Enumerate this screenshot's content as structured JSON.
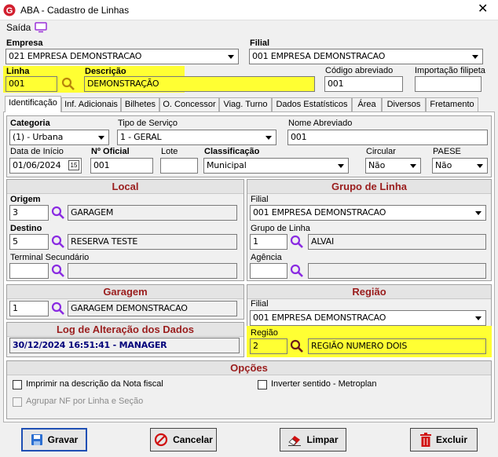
{
  "window": {
    "title": "ABA - Cadastro de Linhas"
  },
  "menu": {
    "saida": "Saída"
  },
  "empresa": {
    "label": "Empresa",
    "value": "021 EMPRESA DEMONSTRACAO"
  },
  "filial": {
    "label": "Filial",
    "value": "001 EMPRESA DEMONSTRACAO"
  },
  "linha": {
    "label": "Linha",
    "value": "001"
  },
  "descricao": {
    "label": "Descrição",
    "value": "DEMONSTRAÇÃO"
  },
  "codigo_abreviado": {
    "label": "Código abreviado",
    "value": "001"
  },
  "importacao": {
    "label": "Importação filipeta",
    "value": ""
  },
  "tabs": [
    "Identificação",
    "Inf. Adicionais",
    "Bilhetes",
    "O. Concessor",
    "Viag. Turno",
    "Dados Estatísticos",
    "Área",
    "Diversos",
    "Fretamento"
  ],
  "ident": {
    "categoria": {
      "label": "Categoria",
      "value": "(1) - Urbana"
    },
    "tipo_servico": {
      "label": "Tipo de Serviço",
      "value": "1 - GERAL"
    },
    "nome_abreviado": {
      "label": "Nome Abreviado",
      "value": "001"
    },
    "data_inicio": {
      "label": "Data de Início",
      "value": "01/06/2024",
      "cal": "15"
    },
    "n_oficial": {
      "label": "Nº Oficial",
      "value": "001"
    },
    "lote": {
      "label": "Lote",
      "value": ""
    },
    "classificacao": {
      "label": "Classificação",
      "value": "Municipal"
    },
    "circular": {
      "label": "Circular",
      "value": "Não"
    },
    "paese": {
      "label": "PAESE",
      "value": "Não"
    }
  },
  "local": {
    "title": "Local",
    "origem": {
      "label": "Origem",
      "code": "3",
      "name": "GARAGEM"
    },
    "destino": {
      "label": "Destino",
      "code": "5",
      "name": "RESERVA TESTE"
    },
    "terminal": {
      "label": "Terminal Secundário",
      "code": "",
      "name": ""
    }
  },
  "grupo_linha": {
    "title": "Grupo de Linha",
    "filial_label": "Filial",
    "filial_value": "001 EMPRESA DEMONSTRACAO",
    "grupo_label": "Grupo de Linha",
    "grupo_code": "1",
    "grupo_name": "ALVAI",
    "agencia_label": "Agência",
    "agencia_code": "",
    "agencia_name": ""
  },
  "garagem": {
    "title": "Garagem",
    "code": "1",
    "name": "GARAGEM DEMONSTRACAO"
  },
  "log": {
    "title": "Log de Alteração dos Dados",
    "value": "30/12/2024 16:51:41 - MANAGER"
  },
  "regiao": {
    "title": "Região",
    "filial_label": "Filial",
    "filial_value": "001 EMPRESA DEMONSTRACAO",
    "regiao_label": "Região",
    "code": "2",
    "name": "REGIÃO NUMERO DOIS"
  },
  "opcoes": {
    "title": "Opções",
    "imprimir": "Imprimir na descrição da Nota fiscal",
    "inverter": "Inverter sentido - Metroplan",
    "agrupar": "Agrupar NF por Linha e Seção"
  },
  "buttons": {
    "gravar": "Gravar",
    "cancelar": "Cancelar",
    "limpar": "Limpar",
    "excluir": "Excluir"
  },
  "colors": {
    "highlight": "#ffff33",
    "section_title": "#9a1d1d",
    "log_text": "#00007a"
  }
}
